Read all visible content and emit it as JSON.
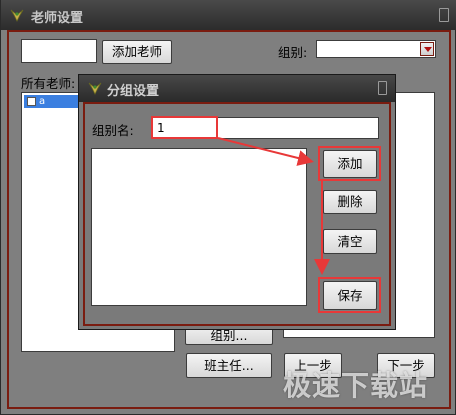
{
  "main_window": {
    "title": "老师设置",
    "add_teacher_button": "添加老师",
    "teacher_name_value": "",
    "group_label": "组别:",
    "group_select_value": "",
    "all_teachers_label": "所有老师:",
    "teachers": [
      {
        "name": "a",
        "checked": false,
        "selected": true
      }
    ],
    "group_button": "组别...",
    "head_teacher_button": "班主任...",
    "prev_button": "上一步",
    "next_button": "下一步"
  },
  "dialog": {
    "title": "分组设置",
    "group_name_label": "组别名:",
    "group_name_value": "1",
    "group_name_extra_value": "",
    "add_button": "添加",
    "delete_button": "删除",
    "clear_button": "清空",
    "save_button": "保存",
    "groups": []
  },
  "annotation": {
    "highlight_color": "#e83838"
  },
  "watermark": {
    "text": "极速下载站"
  },
  "colors": {
    "window_bg": "#7f7f7f",
    "titlebar_bg": "#2c2c2c",
    "frame_border": "#7a1c10",
    "selection": "#3b7fe0"
  }
}
